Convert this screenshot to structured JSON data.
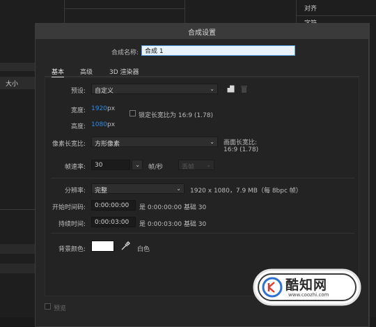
{
  "background_app": {
    "right_panel_label": "对齐",
    "right_panel_label_2": "字符",
    "left_panel_label": "大小"
  },
  "dialog": {
    "title": "合成设置",
    "comp_name_label": "合成名称:",
    "comp_name_value": "合成 1",
    "tabs": [
      {
        "label": "基本",
        "active": true
      },
      {
        "label": "高级",
        "active": false
      },
      {
        "label": "3D 渲染器",
        "active": false
      }
    ],
    "preset_label": "预设:",
    "preset_value": "自定义",
    "width_label": "宽度:",
    "width_value": "1920",
    "width_unit": "px",
    "height_label": "高度:",
    "height_value": "1080",
    "height_unit": "px",
    "lock_aspect_label": "锁定长宽比为 16:9 (1.78)",
    "lock_aspect_checked": false,
    "pixel_aspect_label": "像素长宽比:",
    "pixel_aspect_value": "方形像素",
    "frame_aspect_label": "画面长宽比:",
    "frame_aspect_value": "16:9 (1.78)",
    "frame_rate_label": "帧速率:",
    "frame_rate_value": "30",
    "frame_rate_unit": "帧/秒",
    "drop_frame_value": "丢帧",
    "resolution_label": "分辨率:",
    "resolution_value": "完整",
    "resolution_info": "1920 x 1080，7.9 MB（每 8bpc 帧）",
    "start_timecode_label": "开始时间码:",
    "start_timecode_value": "0:00:00:00",
    "start_timecode_info": "是 0:00:00:00  基础 30",
    "duration_label": "持续时间:",
    "duration_value": "0:00:03:00",
    "duration_info": "是 0:00:03:00  基础 30",
    "bg_color_label": "背景颜色:",
    "bg_color_hex": "#ffffff",
    "bg_color_name": "白色",
    "preview_label": "预览",
    "preview_checked": false
  },
  "watermark": {
    "brand": "酷知网",
    "url": "www.coozhi.com"
  },
  "colors": {
    "accent_blue": "#2f8be6",
    "dialog_bg": "#262626",
    "titlebar_bg": "#3a3a3a"
  }
}
